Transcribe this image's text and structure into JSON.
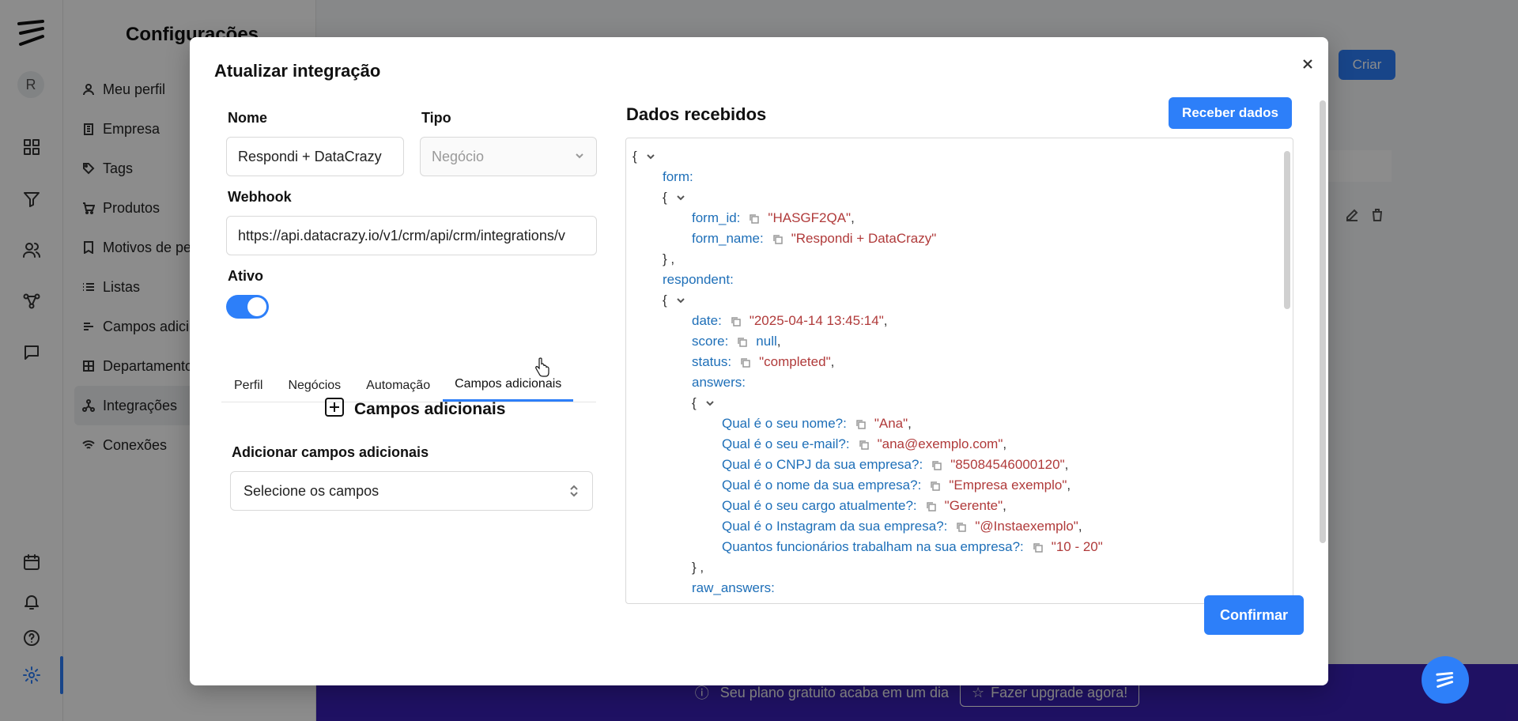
{
  "background": {
    "avatar_initial": "R",
    "settings_title": "Configurações",
    "menu": [
      {
        "label": "Meu perfil",
        "icon": "user-icon"
      },
      {
        "label": "Empresa",
        "icon": "building-icon"
      },
      {
        "label": "Tags",
        "icon": "tag-icon"
      },
      {
        "label": "Produtos",
        "icon": "cart-icon"
      },
      {
        "label": "Motivos de pe",
        "icon": "bookmark-icon"
      },
      {
        "label": "Listas",
        "icon": "list-icon"
      },
      {
        "label": "Campos adici",
        "icon": "fields-icon"
      },
      {
        "label": "Departamento",
        "icon": "grid-icon"
      },
      {
        "label": "Integrações",
        "icon": "integration-icon"
      },
      {
        "label": "Conexões",
        "icon": "wifi-icon"
      }
    ],
    "criar_label": "Criar",
    "banner_text": "Seu plano gratuito acaba em um dia",
    "upgrade_label": "Fazer upgrade agora!"
  },
  "modal": {
    "title": "Atualizar integração",
    "nome_label": "Nome",
    "nome_value": "Respondi + DataCrazy",
    "tipo_label": "Tipo",
    "tipo_value": "Negócio",
    "webhook_label": "Webhook",
    "webhook_value": "https://api.datacrazy.io/v1/crm/api/crm/integrations/v",
    "ativo_label": "Ativo",
    "ativo_on": true,
    "tabs": [
      "Perfil",
      "Negócios",
      "Automação",
      "Campos adicionais"
    ],
    "active_tab": "Campos adicionais",
    "section_title": "Campos adicionais",
    "add_fields_label": "Adicionar campos adicionais",
    "select_placeholder": "Selecione os campos",
    "dados_title": "Dados recebidos",
    "receber_label": "Receber dados",
    "confirmar_label": "Confirmar",
    "json": {
      "form_key": "form:",
      "form_id_key": "form_id:",
      "form_id_val": "\"HASGF2QA\"",
      "form_name_key": "form_name:",
      "form_name_val": "\"Respondi + DataCrazy\"",
      "respondent_key": "respondent:",
      "date_key": "date:",
      "date_val": "\"2025-04-14 13:45:14\"",
      "score_key": "score:",
      "score_val": "null",
      "status_key": "status:",
      "status_val": "\"completed\"",
      "answers_key": "answers:",
      "answers": [
        {
          "k": "Qual é o seu nome?:",
          "v": "\"Ana\""
        },
        {
          "k": "Qual é o seu e-mail?:",
          "v": "\"ana@exemplo.com\""
        },
        {
          "k": "Qual é o CNPJ da sua empresa?:",
          "v": "\"85084546000120\""
        },
        {
          "k": "Qual é o nome da sua empresa?:",
          "v": "\"Empresa exemplo\""
        },
        {
          "k": "Qual é o seu cargo atualmente?:",
          "v": "\"Gerente\""
        },
        {
          "k": "Qual é o Instagram da sua empresa?:",
          "v": "\"@Instaexemplo\""
        },
        {
          "k": "Quantos funcionários trabalham na sua empresa?:",
          "v": "\"10 - 20\""
        }
      ],
      "raw_answers_key": "raw_answers:"
    }
  },
  "colors": {
    "accent": "#2d7ff9",
    "json_key": "#1e6fb8",
    "json_string": "#b03a3a",
    "banner": "#3a1fb5"
  }
}
